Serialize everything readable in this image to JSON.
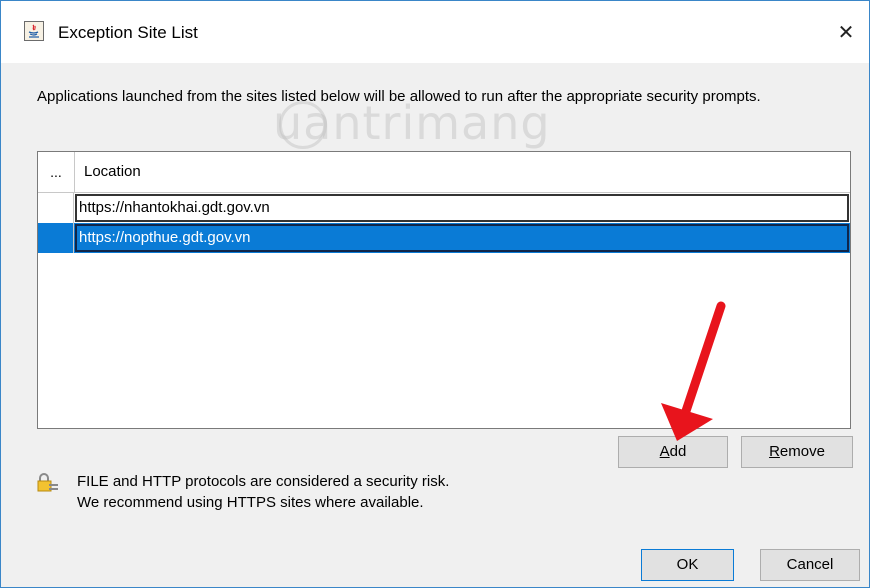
{
  "window": {
    "title": "Exception Site List",
    "close_glyph": "✕",
    "icon": "java-icon"
  },
  "description": "Applications launched from the sites listed below will be allowed to run after the appropriate security prompts.",
  "watermark": "uantrimang",
  "table": {
    "headers": [
      "...",
      "Location"
    ],
    "rows": [
      {
        "location": "https://nhantokhai.gdt.gov.vn",
        "selected": false
      },
      {
        "location": "https://nopthue.gdt.gov.vn",
        "selected": true
      }
    ]
  },
  "buttons": {
    "add_mnemonic": "A",
    "add_rest": "dd",
    "remove_mnemonic": "R",
    "remove_rest": "emove",
    "ok": "OK",
    "cancel": "Cancel"
  },
  "warning": {
    "icon": "lock-icon",
    "line1": "FILE and HTTP protocols are considered a security risk.",
    "line2": "We recommend using HTTPS sites where available."
  },
  "colors": {
    "selection": "#0a7bd6",
    "annotation_arrow": "#e8141c",
    "window_border": "#3a86c8"
  }
}
